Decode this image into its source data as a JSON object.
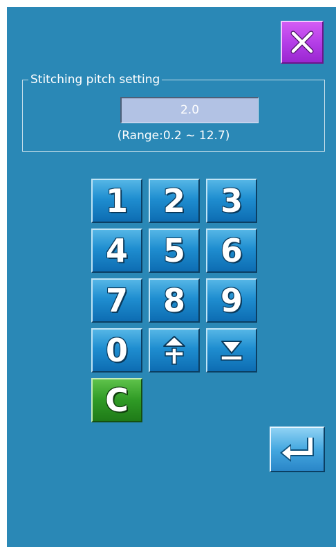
{
  "dialog": {
    "group_title": "Stitching pitch setting",
    "value": "2.0",
    "range_text": "(Range:0.2 ~ 12.7)"
  },
  "keypad": {
    "keys": [
      "1",
      "2",
      "3",
      "4",
      "5",
      "6",
      "7",
      "8",
      "9",
      "0"
    ],
    "clear_label": "C",
    "plus_minus_icon": "plus-minus-icon",
    "arrow_down_icon": "arrow-down-icon"
  },
  "buttons": {
    "close_icon": "close-icon",
    "enter_icon": "enter-icon"
  },
  "colors": {
    "background": "#2a88b6",
    "close_button": "#b23ce6",
    "key_blue": "#1f8ed0",
    "clear_green": "#2f9a25",
    "value_field": "#b2c2e4"
  }
}
